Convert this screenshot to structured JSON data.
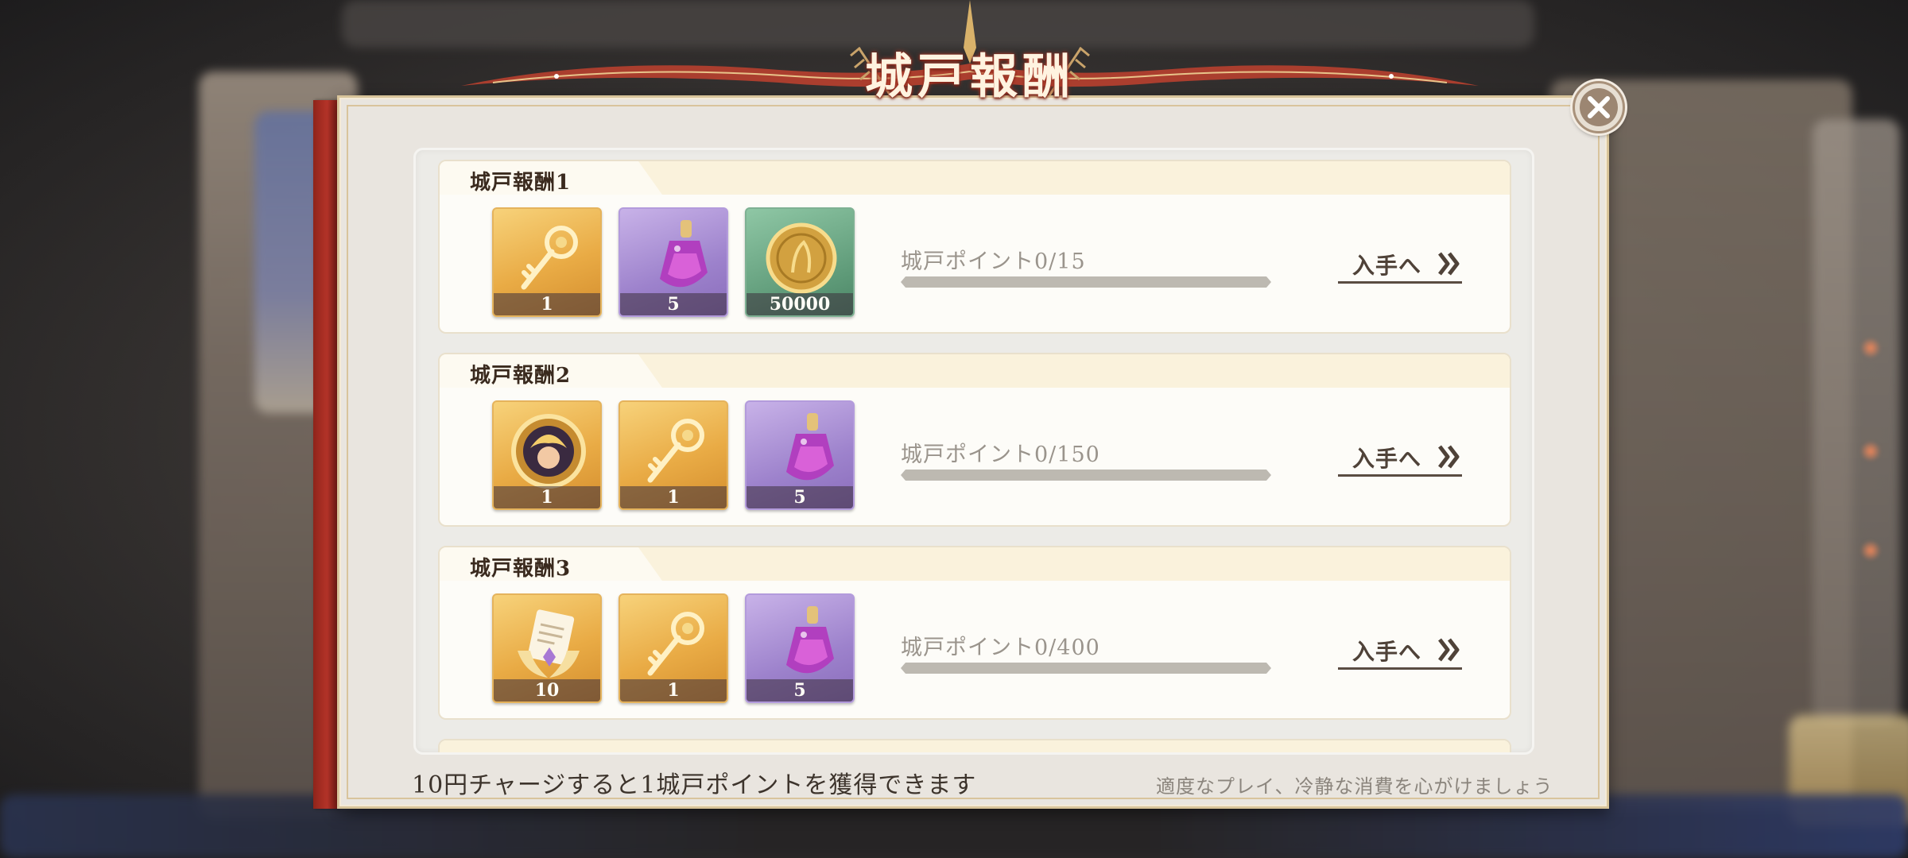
{
  "header": {
    "title": "城戸報酬"
  },
  "rewards": [
    {
      "title": "城戸報酬1",
      "items": [
        {
          "icon": "gold-key-icon",
          "count": "1",
          "rarity": "gold"
        },
        {
          "icon": "purple-potion-icon",
          "count": "5",
          "rarity": "purple"
        },
        {
          "icon": "gold-coin-icon",
          "count": "50000",
          "rarity": "green"
        }
      ],
      "points_text": "城戸ポイント0/15",
      "progress": 0,
      "go_label": "入手へ"
    },
    {
      "title": "城戸報酬2",
      "items": [
        {
          "icon": "character-medal-icon",
          "count": "1",
          "rarity": "gold"
        },
        {
          "icon": "gold-key-icon",
          "count": "1",
          "rarity": "gold"
        },
        {
          "icon": "purple-potion-icon",
          "count": "5",
          "rarity": "purple"
        }
      ],
      "points_text": "城戸ポイント0/150",
      "progress": 0,
      "go_label": "入手へ"
    },
    {
      "title": "城戸報酬3",
      "items": [
        {
          "icon": "winged-letter-icon",
          "count": "10",
          "rarity": "gold"
        },
        {
          "icon": "gold-key-icon",
          "count": "1",
          "rarity": "gold"
        },
        {
          "icon": "purple-potion-icon",
          "count": "5",
          "rarity": "purple"
        }
      ],
      "points_text": "城戸ポイント0/400",
      "progress": 0,
      "go_label": "入手へ"
    }
  ],
  "footer": {
    "charge_note": "10円チャージすると1城戸ポイントを獲得できます",
    "play_note": "適度なプレイ、冷静な消費を心がけましょう"
  },
  "colors": {
    "panel": "#e9e5df",
    "accent_red": "#b9352a",
    "gold_frame": "#d8c49a",
    "progress_track": "#bdb9b1"
  }
}
